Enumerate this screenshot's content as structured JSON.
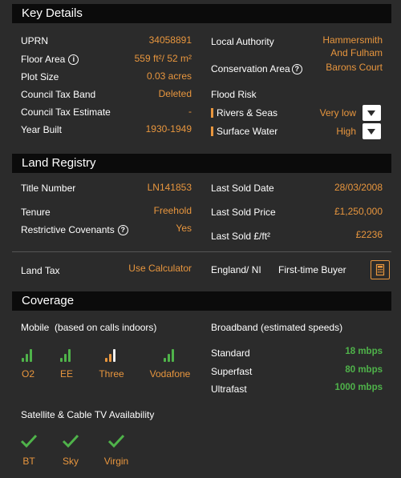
{
  "key_details": {
    "title": "Key Details",
    "uprn_label": "UPRN",
    "uprn": "34058891",
    "floor_area_label": "Floor Area",
    "floor_area": "559 ft²/ 52 m²",
    "plot_size_label": "Plot Size",
    "plot_size": "0.03 acres",
    "council_tax_band_label": "Council Tax Band",
    "council_tax_band": "Deleted",
    "council_tax_estimate_label": "Council Tax Estimate",
    "council_tax_estimate": "-",
    "year_built_label": "Year Built",
    "year_built": "1930-1949",
    "local_authority_label": "Local Authority",
    "local_authority_line1": "Hammersmith",
    "local_authority_line2": "And Fulham",
    "conservation_area_label": "Conservation Area",
    "conservation_area": "Barons Court",
    "flood_risk_label": "Flood Risk",
    "rivers_seas_label": "Rivers & Seas",
    "rivers_seas": "Very low",
    "surface_water_label": "Surface Water",
    "surface_water": "High"
  },
  "land_registry": {
    "title": "Land Registry",
    "title_number_label": "Title Number",
    "title_number": "LN141853",
    "tenure_label": "Tenure",
    "tenure": "Freehold",
    "restrictive_covenants_label": "Restrictive Covenants",
    "restrictive_covenants": "Yes",
    "last_sold_date_label": "Last Sold Date",
    "last_sold_date": "28/03/2008",
    "last_sold_price_label": "Last Sold Price",
    "last_sold_price": "£1,250,000",
    "last_sold_sqft_label": "Last Sold £/ft²",
    "last_sold_sqft": "£2236",
    "land_tax_label": "Land Tax",
    "land_tax": "Use Calculator",
    "england_ni_label": "England/ NI",
    "first_time_buyer_label": "First-time Buyer"
  },
  "coverage": {
    "title": "Coverage",
    "mobile_label": "Mobile  (based on calls indoors)",
    "operators": [
      {
        "name": "O2",
        "signal_level": 1.0
      },
      {
        "name": "EE",
        "signal_level": 1.0
      },
      {
        "name": "Three",
        "signal_level": 0.5
      },
      {
        "name": "Vodafone",
        "signal_level": 1.0
      }
    ],
    "broadband_label": "Broadband (estimated speeds)",
    "broadband": [
      {
        "label": "Standard",
        "speed": "18 mbps"
      },
      {
        "label": "Superfast",
        "speed": "80 mbps"
      },
      {
        "label": "Ultrafast",
        "speed": "1000 mbps"
      }
    ],
    "tv_label": "Satellite & Cable TV Availability",
    "tv_providers": [
      "BT",
      "Sky",
      "Virgin"
    ]
  },
  "colors": {
    "accent": "#e8963e",
    "green": "#4fb34a",
    "header_bg": "#0b0b0b",
    "body_bg": "#2b2b2b"
  },
  "icons": [
    "info-icon",
    "signal-icon",
    "chevron-down-icon",
    "calculator-icon",
    "checkmark-icon"
  ]
}
